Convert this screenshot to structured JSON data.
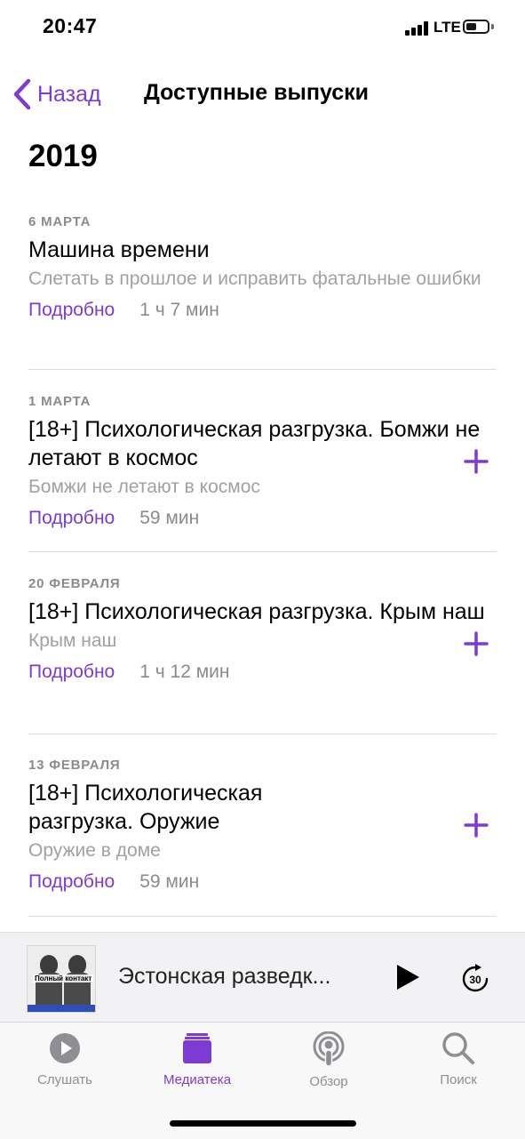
{
  "status_bar": {
    "time": "20:47",
    "network": "LTE"
  },
  "nav": {
    "back_label": "Назад",
    "title": "Доступные выпуски"
  },
  "section": {
    "year": "2019"
  },
  "colors": {
    "accent": "#7e3bd1",
    "secondary_text": "#8a8a8f",
    "description_text": "#a0a0a5"
  },
  "episodes": [
    {
      "date": "6 МАРТА",
      "title": "Машина времени",
      "description": "Слетать в прошлое и исправить фатальные ошибки",
      "more_label": "Подробно",
      "duration": "1 ч 7 мин",
      "has_add": false
    },
    {
      "date": "1 МАРТА",
      "title": "[18+] Психологическая разгрузка. Бомжи не летают в космос",
      "description": "Бомжи не летают в космос",
      "more_label": "Подробно",
      "duration": "59 мин",
      "has_add": true
    },
    {
      "date": "20 ФЕВРАЛЯ",
      "title": "[18+] Психологическая разгрузка. Крым наш",
      "description": "Крым наш",
      "more_label": "Подробно",
      "duration": "1 ч 12 мин",
      "has_add": true
    },
    {
      "date": "13 ФЕВРАЛЯ",
      "title": "[18+] Психологическая разгрузка. Оружие",
      "description": "Оружие в доме",
      "more_label": "Подробно",
      "duration": "59 мин",
      "has_add": true
    }
  ],
  "mini_player": {
    "artwork_title": "Полный контакт",
    "now_playing": "Эстонская разведк...",
    "skip_seconds": "30"
  },
  "tabs": [
    {
      "label": "Слушать",
      "icon": "play-circle-icon",
      "active": false
    },
    {
      "label": "Медиатека",
      "icon": "library-icon",
      "active": true
    },
    {
      "label": "Обзор",
      "icon": "podcast-icon",
      "active": false
    },
    {
      "label": "Поиск",
      "icon": "search-icon",
      "active": false
    }
  ]
}
